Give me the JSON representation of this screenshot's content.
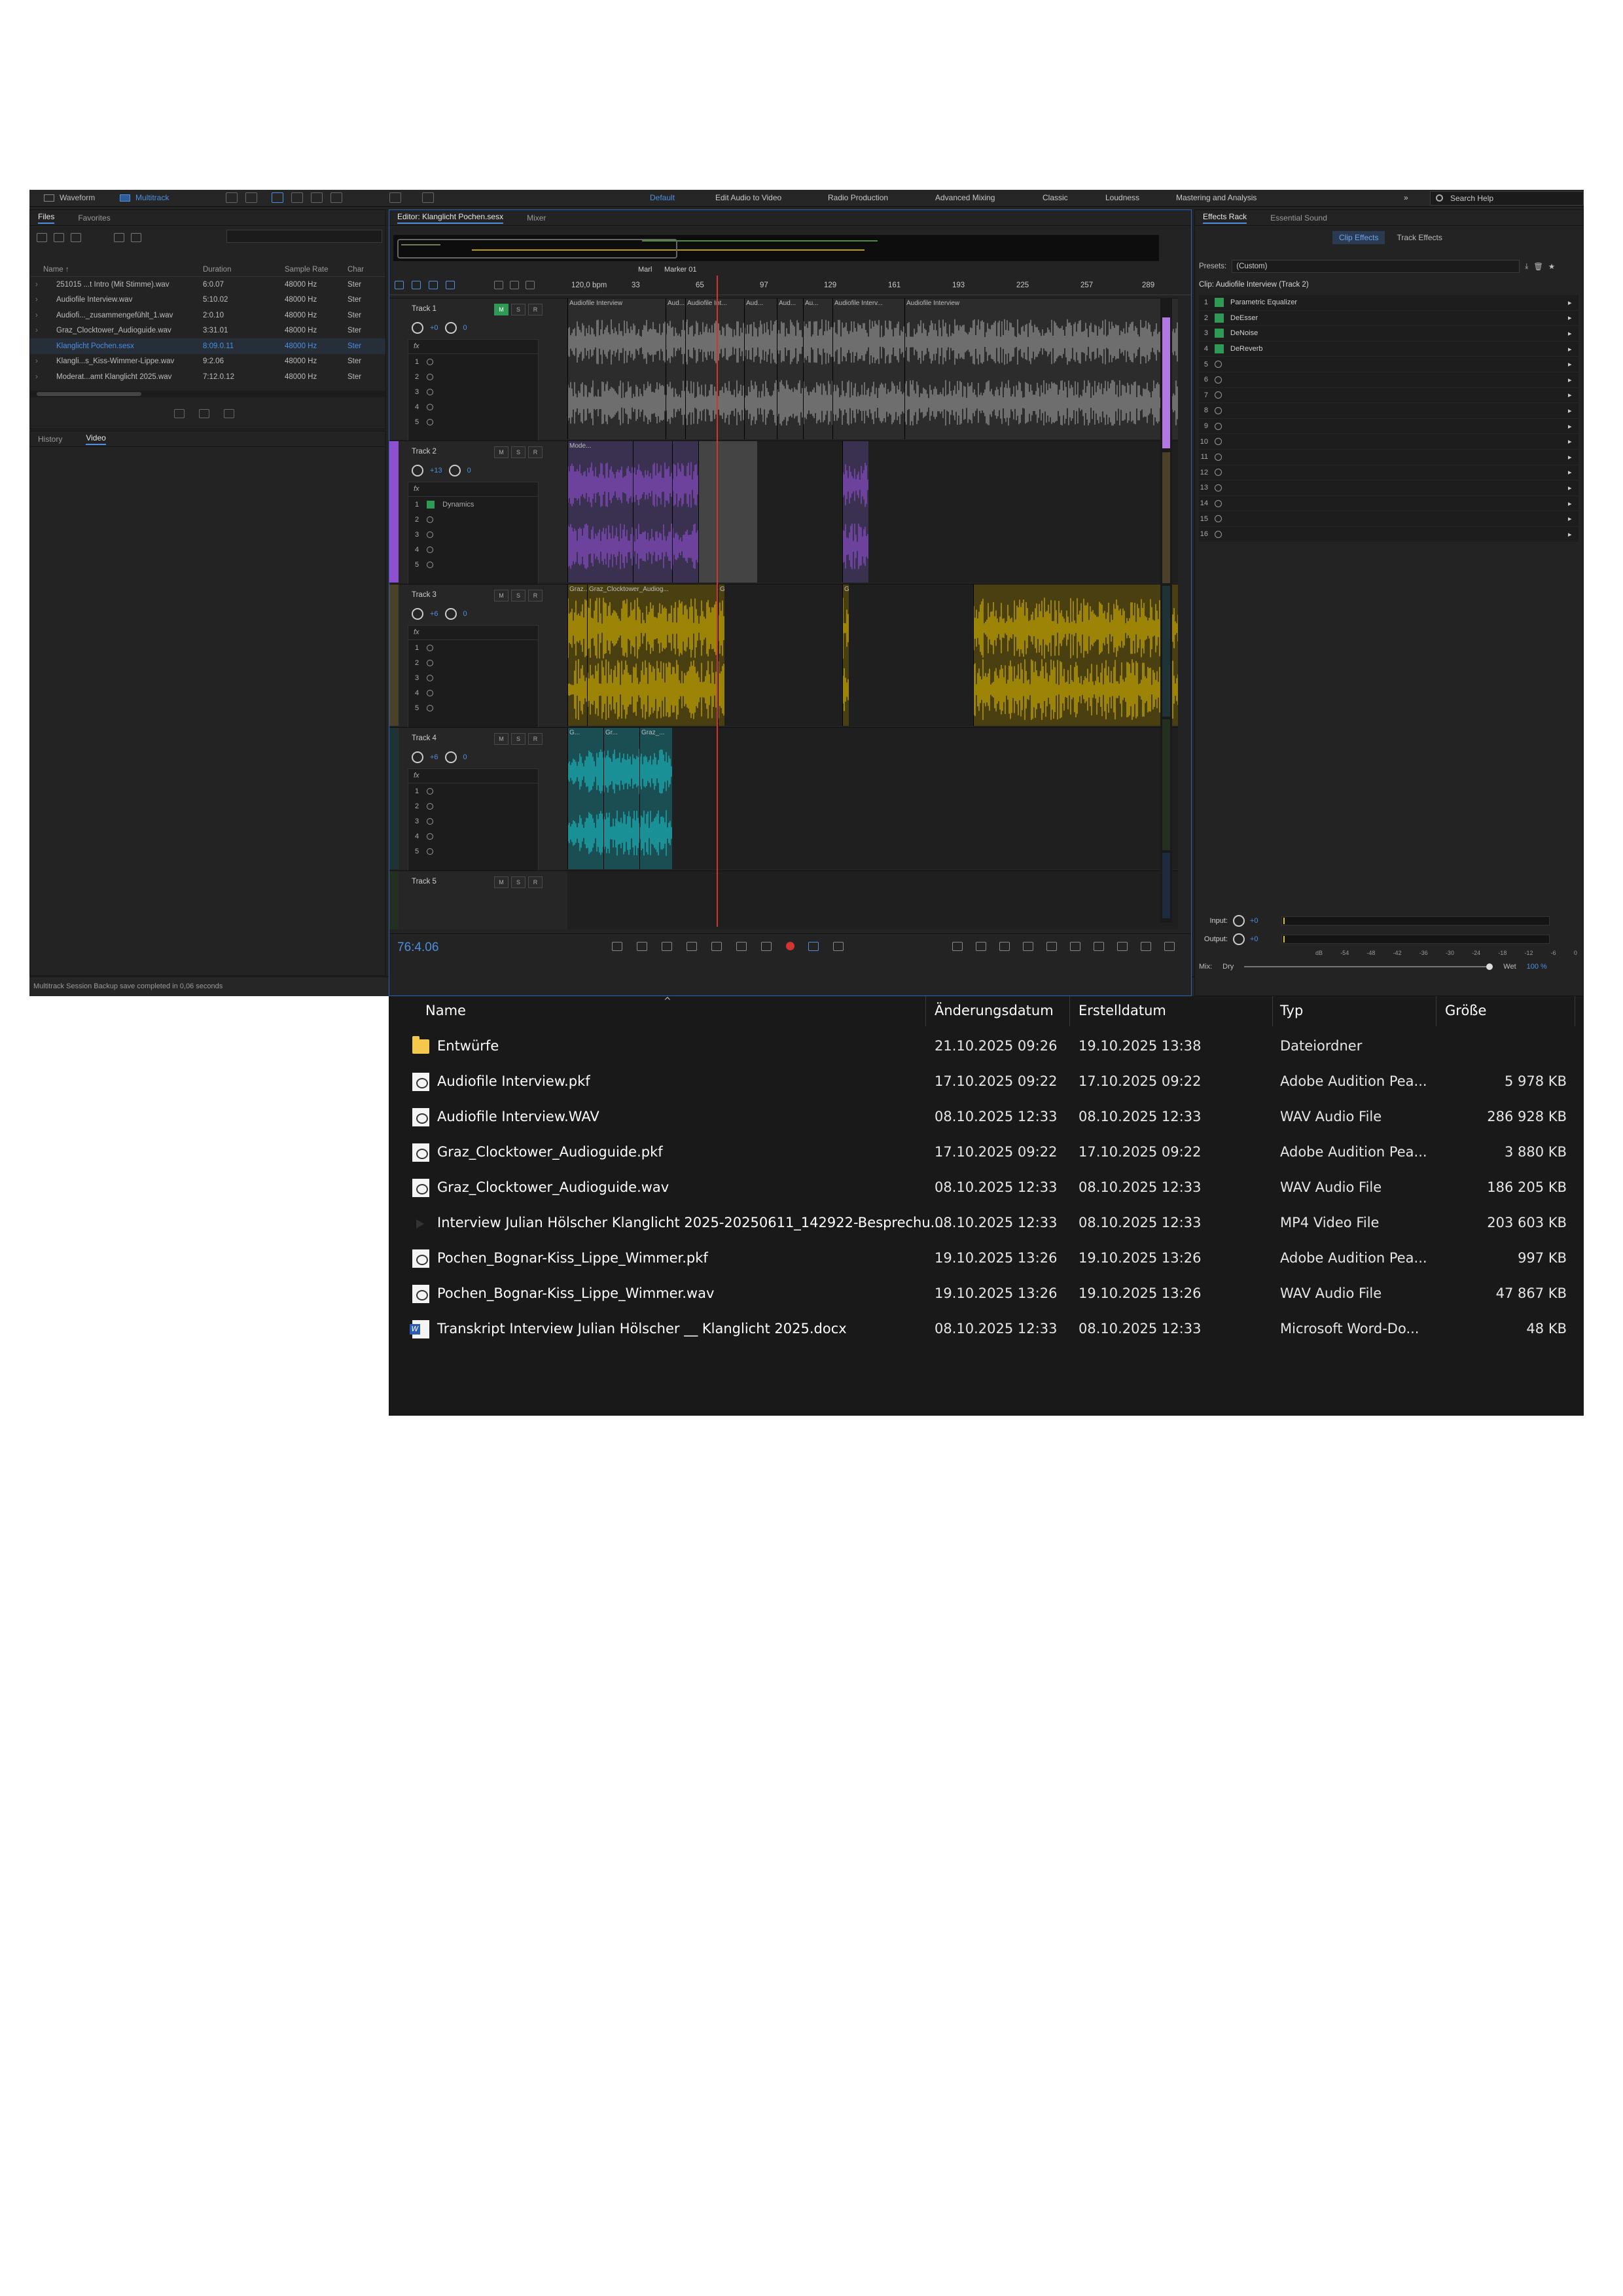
{
  "audition": {
    "modes": [
      "Waveform",
      "Multitrack"
    ],
    "active_mode": "Multitrack",
    "workspaces": [
      "Default",
      "Edit Audio to Video",
      "Radio Production",
      "Advanced Mixing",
      "Classic",
      "Loudness",
      "Mastering and Analysis"
    ],
    "active_workspace": "Default",
    "search_help": "Search Help",
    "files_panel": {
      "tabs": [
        "Files",
        "Favorites"
      ],
      "columns": [
        "Name ↑",
        "Duration",
        "Sample Rate",
        "Char"
      ],
      "rows": [
        {
          "name": "251015 ...t Intro (Mit Stimme).wav",
          "duration": "6:0.07",
          "rate": "48000 Hz",
          "ch": "Ster"
        },
        {
          "name": "Audiofile Interview.wav",
          "duration": "5:10.02",
          "rate": "48000 Hz",
          "ch": "Ster"
        },
        {
          "name": "Audiofi..._zusammengefühlt_1.wav",
          "duration": "2:0.10",
          "rate": "48000 Hz",
          "ch": "Ster"
        },
        {
          "name": "Graz_Clocktower_Audioguide.wav",
          "duration": "3:31.01",
          "rate": "48000 Hz",
          "ch": "Ster"
        },
        {
          "name": "Klanglicht Pochen.sesx",
          "duration": "8:09.0.11",
          "rate": "48000 Hz",
          "ch": "Ster"
        },
        {
          "name": "Klangli...s_Kiss-Wimmer-Lippe.wav",
          "duration": "9:2.06",
          "rate": "48000 Hz",
          "ch": "Ster"
        },
        {
          "name": "Moderat...amt Klanglicht 2025.wav",
          "duration": "7:12.0.12",
          "rate": "48000 Hz",
          "ch": "Ster"
        }
      ],
      "selected_index": 4
    },
    "history_tabs": [
      "History",
      "Video"
    ],
    "status": "Multitrack Session Backup save completed in 0,06 seconds",
    "editor": {
      "tabs": [
        "Editor: Klanglicht Pochen.sesx",
        "Mixer"
      ],
      "markers": [
        "Marl",
        "Marker 01"
      ],
      "tempo": "120,0 bpm",
      "ruler_ticks": [
        "33",
        "65",
        "97",
        "129",
        "161",
        "193",
        "225",
        "257",
        "289"
      ],
      "timecode": "76:4.06",
      "tracks": [
        {
          "name": "Track 1",
          "volume": "+0",
          "pan": "0",
          "fx": [],
          "automation": "Read"
        },
        {
          "name": "Track 2",
          "volume": "+13",
          "pan": "0",
          "fx": [
            "Dynamics"
          ],
          "automation": "Read"
        },
        {
          "name": "Track 3",
          "volume": "+6",
          "pan": "0",
          "fx": [],
          "automation": "Read"
        },
        {
          "name": "Track 4",
          "volume": "+6",
          "pan": "0",
          "fx": [],
          "automation": "Read"
        },
        {
          "name": "Track 5",
          "volume": "",
          "pan": "",
          "fx": [],
          "automation": ""
        }
      ],
      "clips_track1": [
        "Audiofile Interview",
        "Aud...",
        "Audiofile Int...",
        "Aud...",
        "Aud...",
        "Au...",
        "Audiofile Interv...",
        "Audiofile Interview"
      ],
      "clips_track2": [
        "Mode..."
      ],
      "clips_track3": [
        "Graz...",
        "Graz_Clocktower_Audiog...",
        "G...",
        "Graz_Clocktower_Audioguide"
      ],
      "clips_track4": [
        "G...",
        "Gr...",
        "Graz_..."
      ],
      "msr": [
        "M",
        "S",
        "R"
      ],
      "colors": {
        "track1": "#9a9a9a",
        "track2": "#8e4fd0",
        "track3": "#d4b200",
        "track4": "#1bbdc4",
        "playhead": "#d0352f",
        "accent": "#4e8fe0"
      }
    },
    "effects": {
      "tabs": [
        "Effects Rack",
        "Essential Sound"
      ],
      "subtabs": [
        "Clip Effects",
        "Track Effects"
      ],
      "presets_label": "Presets:",
      "preset_value": "(Custom)",
      "clip_title": "Clip: Audiofile Interview (Track 2)",
      "slots": [
        {
          "n": "1",
          "name": "Parametric Equalizer"
        },
        {
          "n": "2",
          "name": "DeEsser"
        },
        {
          "n": "3",
          "name": "DeNoise"
        },
        {
          "n": "4",
          "name": "DeReverb"
        },
        {
          "n": "5",
          "name": ""
        },
        {
          "n": "6",
          "name": ""
        },
        {
          "n": "7",
          "name": ""
        },
        {
          "n": "8",
          "name": ""
        },
        {
          "n": "9",
          "name": ""
        },
        {
          "n": "10",
          "name": ""
        },
        {
          "n": "11",
          "name": ""
        },
        {
          "n": "12",
          "name": ""
        },
        {
          "n": "13",
          "name": ""
        },
        {
          "n": "14",
          "name": ""
        },
        {
          "n": "15",
          "name": ""
        },
        {
          "n": "16",
          "name": ""
        }
      ],
      "input_label": "Input:",
      "output_label": "Output:",
      "input_value": "+0",
      "output_value": "+0",
      "db_scale": [
        "dB",
        "-54",
        "-48",
        "-42",
        "-36",
        "-30",
        "-24",
        "-18",
        "-12",
        "-6",
        "0"
      ],
      "mix_label": "Mix:",
      "mix_dry": "Dry",
      "mix_wet": "Wet",
      "mix_value": "100 %"
    }
  },
  "explorer": {
    "columns": [
      "Name",
      "Änderungsdatum",
      "Erstelldatum",
      "Typ",
      "Größe"
    ],
    "rows": [
      {
        "icon": "folder",
        "name": "Entwürfe",
        "modified": "21.10.2025 09:26",
        "created": "19.10.2025 13:38",
        "type": "Dateiordner",
        "size": ""
      },
      {
        "icon": "doc",
        "name": "Audiofile Interview.pkf",
        "modified": "17.10.2025 09:22",
        "created": "17.10.2025 09:22",
        "type": "Adobe Audition Pea...",
        "size": "5 978 KB"
      },
      {
        "icon": "doc",
        "name": "Audiofile Interview.WAV",
        "modified": "08.10.2025 12:33",
        "created": "08.10.2025 12:33",
        "type": "WAV Audio File",
        "size": "286 928 KB"
      },
      {
        "icon": "doc",
        "name": "Graz_Clocktower_Audioguide.pkf",
        "modified": "17.10.2025 09:22",
        "created": "17.10.2025 09:22",
        "type": "Adobe Audition Pea...",
        "size": "3 880 KB"
      },
      {
        "icon": "doc",
        "name": "Graz_Clocktower_Audioguide.wav",
        "modified": "08.10.2025 12:33",
        "created": "08.10.2025 12:33",
        "type": "WAV Audio File",
        "size": "186 205 KB"
      },
      {
        "icon": "video",
        "name": "Interview Julian Hölscher  Klanglicht 2025-20250611_142922-Besprechu...",
        "modified": "08.10.2025 12:33",
        "created": "08.10.2025 12:33",
        "type": "MP4 Video File",
        "size": "203 603 KB"
      },
      {
        "icon": "doc",
        "name": "Pochen_Bognar-Kiss_Lippe_Wimmer.pkf",
        "modified": "19.10.2025 13:26",
        "created": "19.10.2025 13:26",
        "type": "Adobe Audition Pea...",
        "size": "997 KB"
      },
      {
        "icon": "doc",
        "name": "Pochen_Bognar-Kiss_Lippe_Wimmer.wav",
        "modified": "19.10.2025 13:26",
        "created": "19.10.2025 13:26",
        "type": "WAV Audio File",
        "size": "47 867 KB"
      },
      {
        "icon": "word",
        "name": "Transkript Interview Julian Hölscher __ Klanglicht 2025.docx",
        "modified": "08.10.2025 12:33",
        "created": "08.10.2025 12:33",
        "type": "Microsoft Word-Do...",
        "size": "48 KB"
      }
    ]
  }
}
